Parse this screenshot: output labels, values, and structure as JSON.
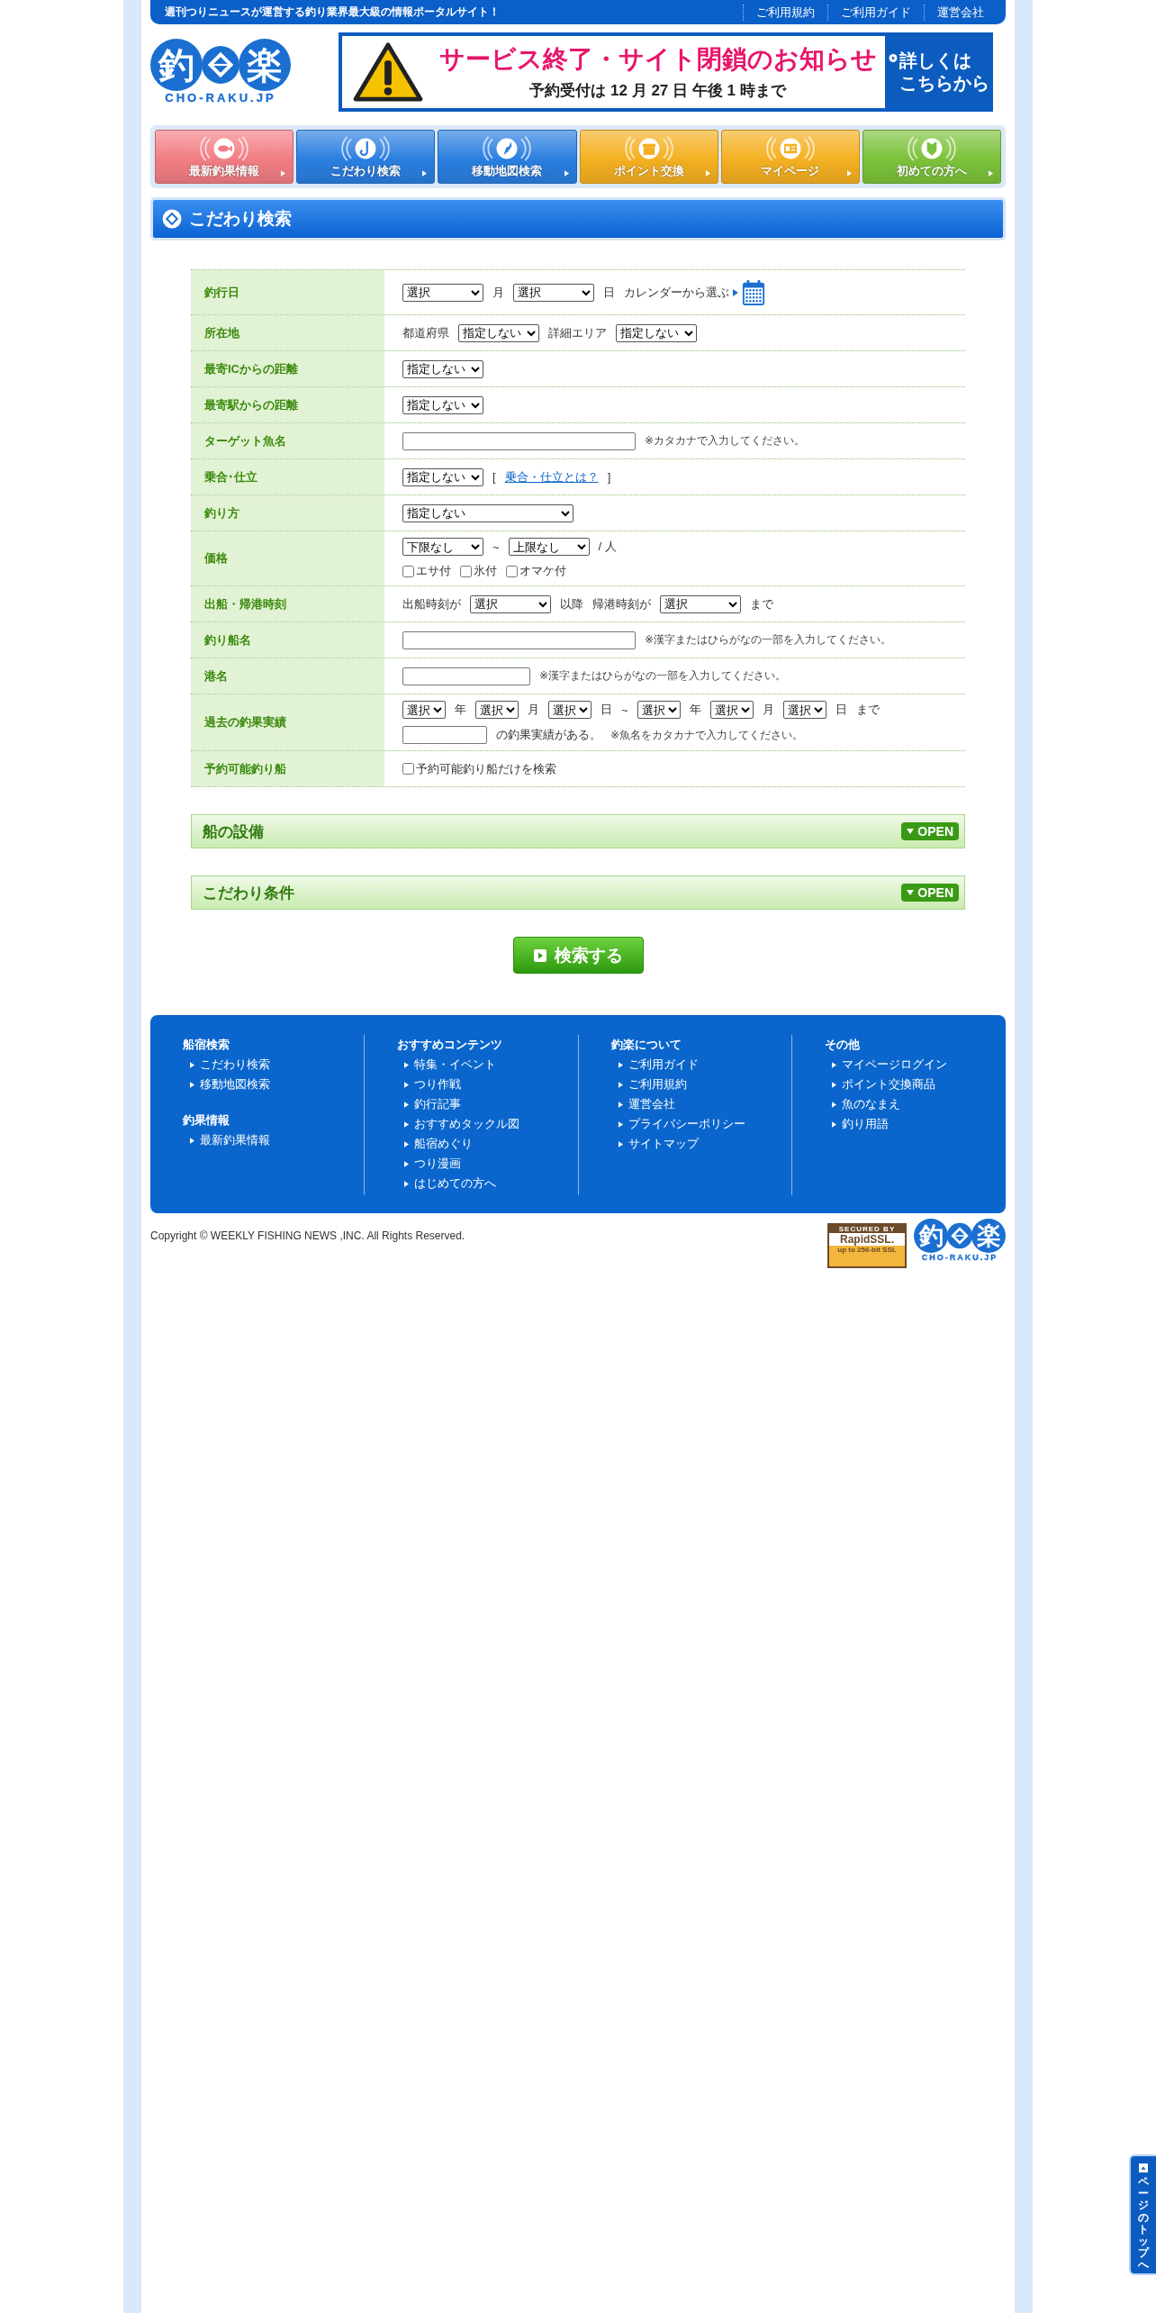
{
  "top_bar": {
    "tagline": "週刊つりニュースが運営する釣り業界最大級の情報ポータルサイト！",
    "links": [
      "ご利用規約",
      "ご利用ガイド",
      "運営会社"
    ]
  },
  "logo": {
    "chars": [
      "釣",
      "楽"
    ],
    "subtitle": "CHO-RAKU.JP"
  },
  "banner": {
    "title": "サービス終了・サイト閉鎖のお知らせ",
    "subtitle": "予約受付は 12 月 27 日 午後 1 時まで",
    "link_lines": [
      "詳しくは",
      "こちらから"
    ]
  },
  "nav": [
    {
      "label": "最新釣果情報",
      "color": "#f27d84"
    },
    {
      "label": "こだわり検索",
      "color": "#2a7fe0"
    },
    {
      "label": "移動地図検索",
      "color": "#2a7fe0"
    },
    {
      "label": "ポイント交換",
      "color": "#f4b021"
    },
    {
      "label": "マイページ",
      "color": "#f4b021"
    },
    {
      "label": "初めての方へ",
      "color": "#7cc23a"
    }
  ],
  "section_title": "こだわり検索",
  "form": {
    "rows": [
      {
        "label": "釣行日",
        "parts": [
          {
            "kind": "select",
            "value": "選択"
          },
          {
            "kind": "text",
            "text": "月"
          },
          {
            "kind": "select",
            "value": "選択"
          },
          {
            "kind": "text",
            "text": "日"
          },
          {
            "kind": "text",
            "text": "カレンダーから選ぶ"
          },
          {
            "kind": "calendar"
          }
        ]
      },
      {
        "label": "所在地",
        "parts": [
          {
            "kind": "text",
            "text": "都道府県"
          },
          {
            "kind": "select",
            "value": "指定しない"
          },
          {
            "kind": "text",
            "text": "詳細エリア"
          },
          {
            "kind": "select",
            "value": "指定しない"
          }
        ]
      },
      {
        "label": "最寄ICからの距離",
        "parts": [
          {
            "kind": "select",
            "value": "指定しない"
          }
        ]
      },
      {
        "label": "最寄駅からの距離",
        "parts": [
          {
            "kind": "select",
            "value": "指定しない"
          }
        ]
      },
      {
        "label": "ターゲット魚名",
        "parts": [
          {
            "kind": "input"
          },
          {
            "kind": "note",
            "text": "※カタカナで入力してください。"
          }
        ]
      },
      {
        "label": "乗合･仕立",
        "parts": [
          {
            "kind": "select",
            "value": "指定しない"
          },
          {
            "kind": "text",
            "text": "["
          },
          {
            "kind": "link",
            "text": "乗合・仕立とは？"
          },
          {
            "kind": "text",
            "text": "]"
          }
        ]
      },
      {
        "label": "釣り方",
        "parts": [
          {
            "kind": "select_wide",
            "value": "指定しない"
          }
        ]
      },
      {
        "label": "価格",
        "parts": [
          {
            "kind": "select",
            "value": "下限なし"
          },
          {
            "kind": "text",
            "text": "~"
          },
          {
            "kind": "select",
            "value": "上限なし"
          },
          {
            "kind": "text",
            "text": "/ 人"
          },
          {
            "kind": "break"
          },
          {
            "kind": "checkbox",
            "text": "エサ付",
            "checked": false
          },
          {
            "kind": "checkbox",
            "text": "氷付",
            "checked": false
          },
          {
            "kind": "checkbox",
            "text": "オマケ付",
            "checked": false
          }
        ]
      },
      {
        "label": "出船・帰港時刻",
        "parts": [
          {
            "kind": "text",
            "text": "出船時刻が"
          },
          {
            "kind": "select",
            "value": "選択"
          },
          {
            "kind": "text",
            "text": "以降"
          },
          {
            "kind": "text",
            "text": "帰港時刻が"
          },
          {
            "kind": "select",
            "value": "選択"
          },
          {
            "kind": "text",
            "text": "まで"
          }
        ]
      },
      {
        "label": "釣り船名",
        "parts": [
          {
            "kind": "input"
          },
          {
            "kind": "note",
            "text": "※漢字またはひらがなの一部を入力してください。"
          }
        ]
      },
      {
        "label": "港名",
        "parts": [
          {
            "kind": "input_short"
          },
          {
            "kind": "note",
            "text": "※漢字またはひらがなの一部を入力してください。"
          }
        ]
      },
      {
        "label": "過去の釣果実績",
        "parts": [
          {
            "kind": "select_small",
            "value": "選択"
          },
          {
            "kind": "text",
            "text": "年"
          },
          {
            "kind": "select_small",
            "value": "選択"
          },
          {
            "kind": "text",
            "text": "月"
          },
          {
            "kind": "select_small",
            "value": "選択"
          },
          {
            "kind": "text",
            "text": "日"
          },
          {
            "kind": "text",
            "text": "~"
          },
          {
            "kind": "select_small",
            "value": "選択"
          },
          {
            "kind": "text",
            "text": "年"
          },
          {
            "kind": "select_small",
            "value": "選択"
          },
          {
            "kind": "text",
            "text": "月"
          },
          {
            "kind": "select_small",
            "value": "選択"
          },
          {
            "kind": "text",
            "text": "日"
          },
          {
            "kind": "text",
            "text": "まで"
          },
          {
            "kind": "break"
          },
          {
            "kind": "input_tiny"
          },
          {
            "kind": "text",
            "text": "の釣果実績がある。"
          },
          {
            "kind": "note",
            "text": "※魚名をカタカナで入力してください。"
          }
        ]
      },
      {
        "label": "予約可能釣り船",
        "parts": [
          {
            "kind": "checkbox",
            "text": "予約可能釣り船だけを検索",
            "checked": false
          }
        ]
      }
    ]
  },
  "panels": [
    {
      "title": "船の設備",
      "button": "OPEN"
    },
    {
      "title": "こだわり条件",
      "button": "OPEN"
    }
  ],
  "search_button": "検索する",
  "footer": {
    "columns": [
      {
        "groups": [
          {
            "title": "船宿検索",
            "links": [
              "こだわり検索",
              "移動地図検索"
            ]
          },
          {
            "title": "釣果情報",
            "links": [
              "最新釣果情報"
            ]
          }
        ]
      },
      {
        "groups": [
          {
            "title": "おすすめコンテンツ",
            "links": [
              "特集・イベント",
              "つり作戦",
              "釣行記事",
              "おすすめタックル図",
              "船宿めぐり",
              "つり漫画",
              "はじめての方へ"
            ]
          }
        ]
      },
      {
        "groups": [
          {
            "title": "釣楽について",
            "links": [
              "ご利用ガイド",
              "ご利用規約",
              "運営会社",
              "プライバシーポリシー",
              "サイトマップ"
            ]
          }
        ]
      },
      {
        "groups": [
          {
            "title": "その他",
            "links": [
              "マイページログイン",
              "ポイント交換商品",
              "魚のなまえ",
              "釣り用語"
            ]
          }
        ]
      }
    ]
  },
  "copyright": "Copyright © WEEKLY FISHING NEWS ,INC. All Rights Reserved.",
  "footer_logo": {
    "chars": [
      "釣",
      "楽"
    ],
    "subtitle": "CHO-RAKU.JP"
  },
  "ssl_badge": [
    "SECURED BY",
    "RapidSSL.",
    "up to 256-bit SSL"
  ],
  "page_top": "ページのトップへ"
}
